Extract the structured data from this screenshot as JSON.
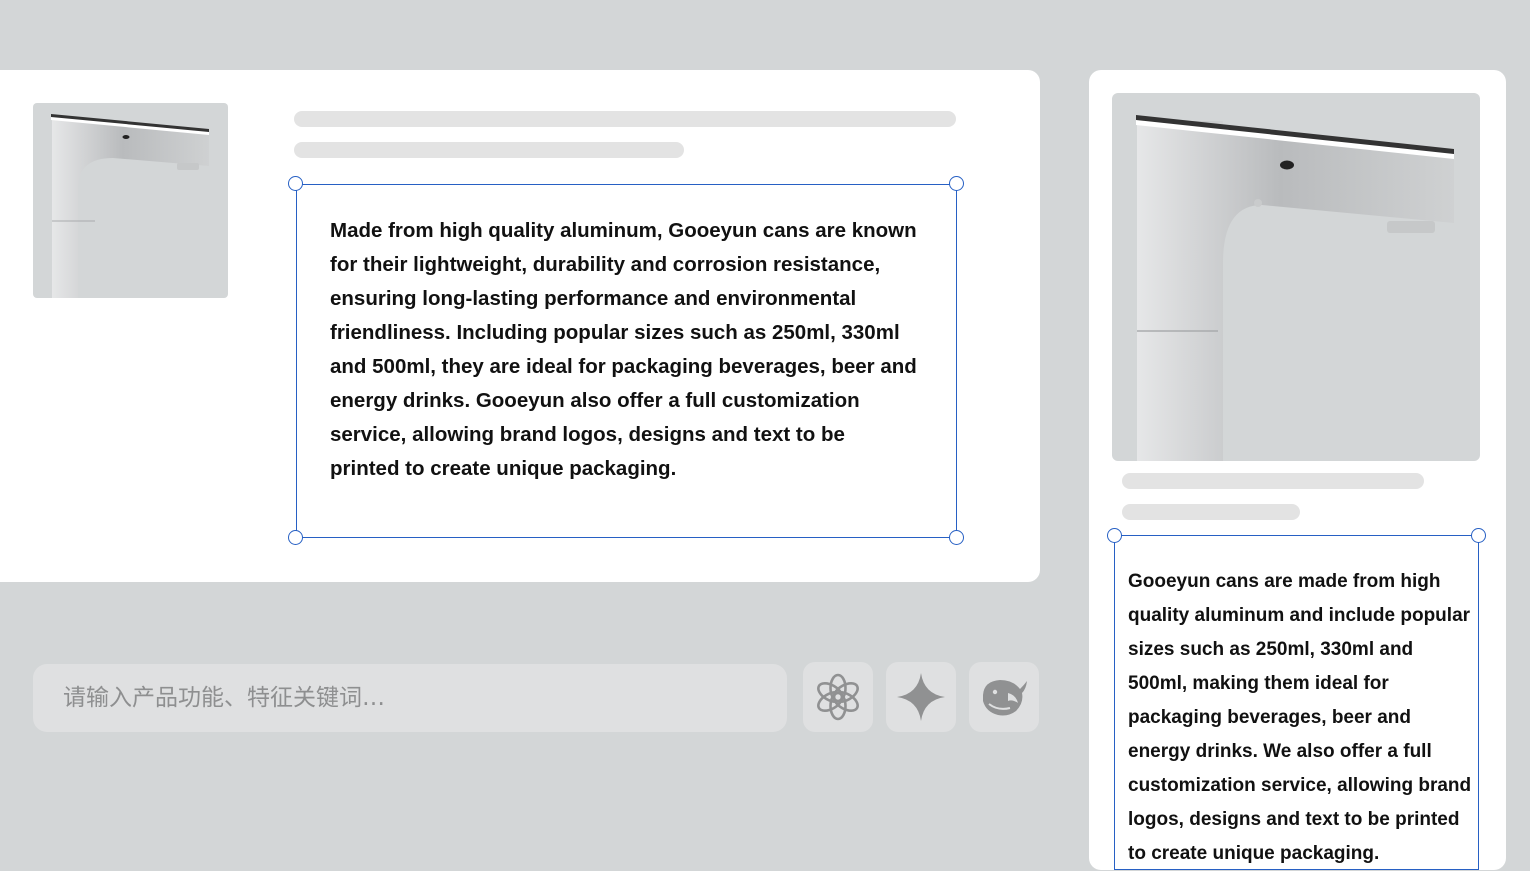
{
  "left_panel": {
    "description": "Made from high quality aluminum, Gooeyun cans are known for their lightweight, durability and corrosion resistance, ensuring long-lasting performance and environmental friendliness. Including popular sizes such as 250ml, 330ml and 500ml, they are ideal for packaging beverages, beer and energy drinks. Gooeyun also offer a full customization service, allowing brand logos, designs and text to be printed to create unique packaging."
  },
  "right_panel": {
    "description": "Gooeyun cans are made from high quality aluminum and include popular sizes such as 250ml, 330ml and 500ml, making them ideal for packaging beverages, beer and energy drinks. We also offer a full customization service, allowing brand logos, designs and text to be printed to create unique packaging."
  },
  "prompt": {
    "value": "",
    "placeholder": "请输入产品功能、特征关键词…"
  },
  "ai_models": {
    "items": [
      {
        "icon": "chatgpt-icon"
      },
      {
        "icon": "gemini-sparkle-icon"
      },
      {
        "icon": "deepseek-whale-icon"
      }
    ]
  },
  "colors": {
    "background": "#d3d6d7",
    "selection": "#2760c4",
    "skeleton": "#e3e3e3",
    "icon": "#909192"
  }
}
